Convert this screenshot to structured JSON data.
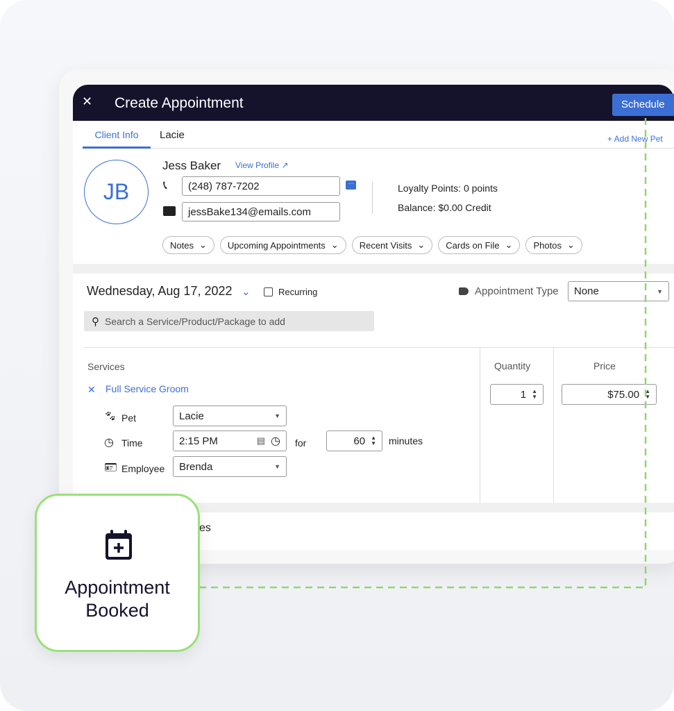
{
  "header": {
    "title": "Create Appointment",
    "close": "✕",
    "schedule": "Schedule"
  },
  "tabs": [
    {
      "label": "Client Info",
      "active": true
    },
    {
      "label": "Lacie",
      "active": false
    }
  ],
  "add_pet": "+ Add New Pet",
  "client": {
    "initials": "JB",
    "name": "Jess Baker",
    "view_profile": "View Profile",
    "phone": "(248) 787-7202",
    "email": "jessBake134@emails.com",
    "loyalty": "Loyalty Points: 0 points",
    "balance": "Balance: $0.00 Credit"
  },
  "pills": [
    "Notes",
    "Upcoming Appointments",
    "Recent Visits",
    "Cards on File",
    "Photos"
  ],
  "appointment": {
    "date": "Wednesday, Aug 17, 2022",
    "recurring": "Recurring",
    "type_label": "Appointment Type",
    "type_value": "None",
    "search_placeholder": "Search a Service/Product/Package to add"
  },
  "services": {
    "header": "Services",
    "quantity_header": "Quantity",
    "price_header": "Price",
    "item": "Full Service Groom",
    "pet_label": "Pet",
    "pet": "Lacie",
    "time_label": "Time",
    "time": "2:15 PM",
    "for": "for",
    "duration": "60",
    "minutes": "minutes",
    "employee_label": "Employee",
    "employee": "Brenda",
    "quantity": "1",
    "price": "$75.00"
  },
  "partial_section": "es",
  "badge": {
    "line1": "Appointment",
    "line2": "Booked"
  },
  "colors": {
    "header": "#15122c",
    "accent": "#3b6fd4",
    "badge_border": "#9be07a",
    "dash": "#8fd86a"
  }
}
